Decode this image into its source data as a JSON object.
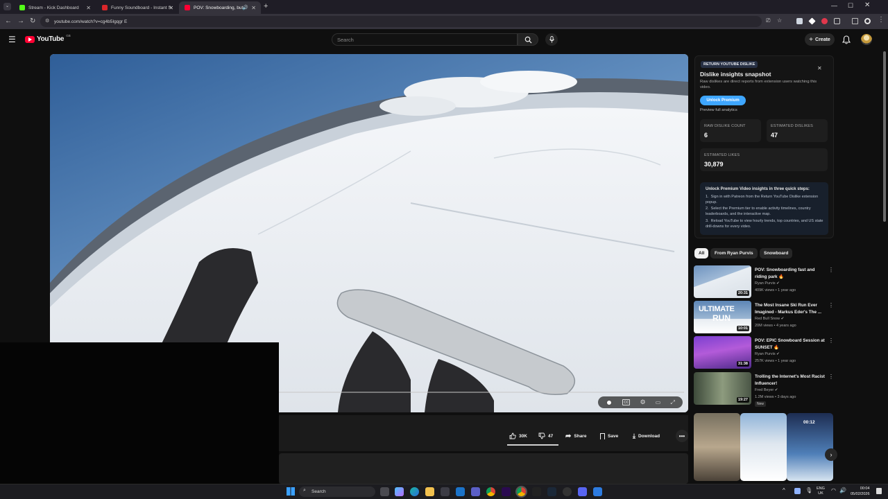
{
  "browser": {
    "tabs": [
      {
        "title": "Stream - Kick Dashboard",
        "color": "#53fc18"
      },
      {
        "title": "Funny Soundboard - Instant So",
        "color": "#d9262a"
      },
      {
        "title": "POV: Snowboarding, but in",
        "color": "#ff0033"
      }
    ],
    "url": "youtube.com/watch?v=cg4b5Igqgr E"
  },
  "youtube": {
    "logo_text": "YouTube",
    "logo_region": "GB",
    "search_placeholder": "Search",
    "create_label": "Create"
  },
  "video": {
    "like_count": "30K",
    "dislike_count": "47",
    "share_label": "Share",
    "save_label": "Save",
    "download_label": "Download"
  },
  "ryd": {
    "badge": "RETURN YOUTUBE DISLIKE",
    "title": "Dislike insights snapshot",
    "subtitle": "Raw dislikes are direct reports from extension users watching this video.",
    "unlock_label": "Unlock Premium",
    "preview_label": "Preview full analytics",
    "raw_label": "RAW DISLIKE COUNT",
    "raw_value": "6",
    "est_dislikes_label": "ESTIMATED DISLIKES",
    "est_dislikes_value": "47",
    "est_likes_label": "ESTIMATED LIKES",
    "est_likes_value": "30,879",
    "steps_title": "Unlock Premium Video insights in three quick steps:",
    "step1": "Sign in with Patreon from the Return YouTube Dislike extension popup.",
    "step2": "Select the Premium tier to enable activity timelines, country leaderboards, and the interactive map.",
    "step3": "Reload YouTube to view hourly trends, top countries, and US state drill-downs for every video."
  },
  "chips": [
    "All",
    "From Ryan Purvis",
    "Snowboard"
  ],
  "recommendations": [
    {
      "title": "POV: Snowboarding fast and riding park 🔥",
      "channel": "Ryan Purvis ✔",
      "meta": "409K views • 1 year ago",
      "duration": "20:31"
    },
    {
      "title": "The Most Insane Ski Run Ever Imagined - Markus Eder's The ...",
      "channel": "Red Bull Snow ✔",
      "meta": "20M views • 4 years ago",
      "duration": "10:01"
    },
    {
      "title": "POV: EPIC Snowboard Session at SUNSET 🔥",
      "channel": "Ryan Purvis ✔",
      "meta": "257K views • 1 year ago",
      "duration": "31:38"
    },
    {
      "title": "Trolling the Internet's Most Racist Influencer!",
      "channel": "Fred Beyer ✔",
      "meta": "1.2M views • 3 days ago",
      "duration": "19:27",
      "badge": "New"
    }
  ],
  "thumb_texts": {
    "ultimate": "ULTIMATE",
    "run": "RUN",
    "short3_top": "00:12"
  },
  "taskbar": {
    "search_label": "Search",
    "lang_top": "ENG",
    "lang_bottom": "UK",
    "time": "00:04",
    "date": "05/02/2026"
  }
}
